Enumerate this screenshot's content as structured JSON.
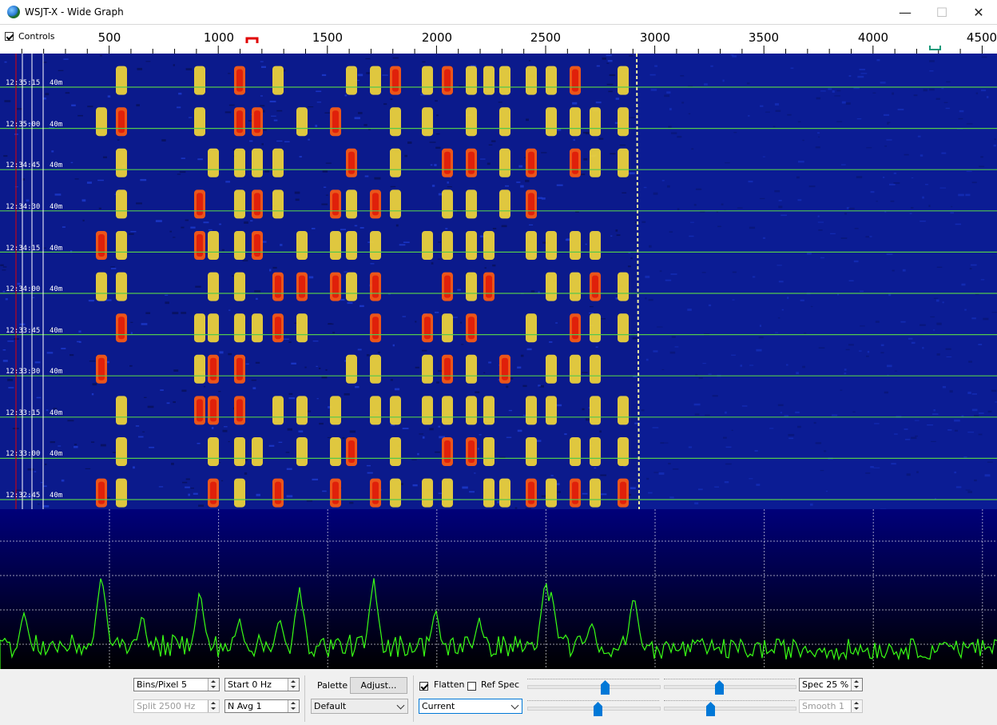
{
  "window": {
    "title": "WSJT-X - Wide Graph",
    "minimize": "—",
    "maximize": "☐",
    "close": "✕"
  },
  "freq_axis": {
    "controls_checked": true,
    "controls_label": "Controls",
    "ticks": [
      "500",
      "1000",
      "1500",
      "2000",
      "2500",
      "3000",
      "3500",
      "4000",
      "4500"
    ]
  },
  "waterfall": {
    "band": "40m",
    "timestamps": [
      "12:35:15",
      "12:35:00",
      "12:34:45",
      "12:34:30",
      "12:34:15",
      "12:34:00",
      "12:33:45",
      "12:33:30",
      "12:33:15",
      "12:33:00",
      "12:32:45"
    ]
  },
  "colors": {
    "waterfall_bg": "#0b1a8c",
    "spectrum_line": "#39ff14",
    "separator": "#53c84e",
    "rx_marker": "#e00000",
    "tx_marker": "#1a9a7a"
  },
  "controls": {
    "bins_pixel": "Bins/Pixel  5",
    "start": "Start 0 Hz",
    "palette_label": "Palette",
    "adjust_button": "Adjust...",
    "flatten_label": "Flatten",
    "flatten_checked": true,
    "refspec_label": "Ref Spec",
    "refspec_checked": false,
    "spec": "Spec 25 %",
    "split": "Split  2500  Hz",
    "navg": "N Avg 1",
    "palette_value": "Default",
    "spectrum_value": "Current",
    "smooth": "Smooth  1"
  }
}
